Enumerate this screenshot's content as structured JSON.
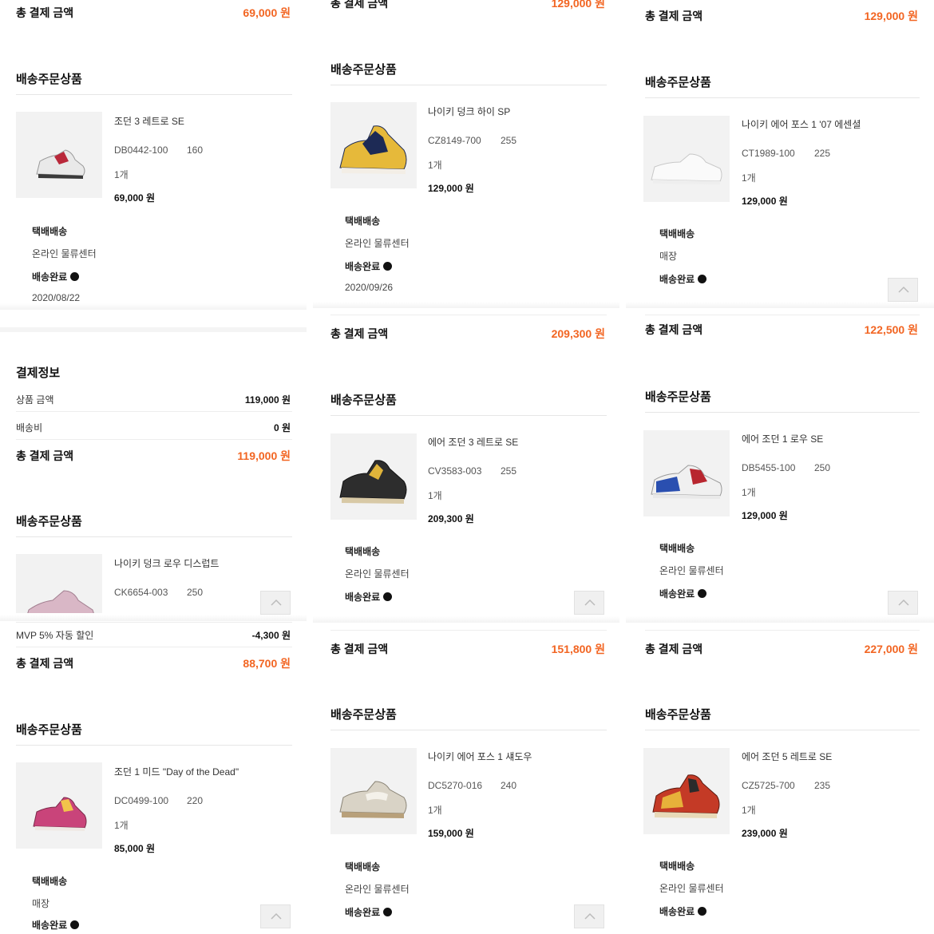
{
  "labels": {
    "total": "총 결제 금액",
    "section": "배송주문상품",
    "payment_info": "결제정보",
    "product_amount": "상품 금액",
    "shipping_fee": "배송비",
    "mvp_discount": "MVP 5% 자동 할인"
  },
  "panels": [
    {
      "id": "p1",
      "top_total": "69,000 원",
      "product": {
        "name": "조던 3 레트로 SE",
        "code": "DB0442-100",
        "size": "160",
        "qty": "1개",
        "price": "69,000 원",
        "icon": "sneaker-white-red-icon"
      },
      "delivery": {
        "method": "택배배송",
        "origin": "온라인 물류센터",
        "status": "배송완료",
        "date": "2020/08/22"
      }
    },
    {
      "id": "p2",
      "payment": {
        "product_amount": "119,000 원",
        "shipping_fee": "0 원",
        "total": "119,000 원"
      },
      "product": {
        "name": "나이키 덩크 로우 디스럽트",
        "code": "CK6654-003",
        "size": "250",
        "icon": "sneaker-pink-icon"
      },
      "discount": "-4,300 원",
      "total": "88,700 원"
    },
    {
      "id": "p3",
      "product": {
        "name": "조던 1 미드 \"Day of the Dead\"",
        "code": "DC0499-100",
        "size": "220",
        "qty": "1개",
        "price": "85,000 원",
        "icon": "sneaker-pink-multi-icon"
      },
      "delivery": {
        "method": "택배배송",
        "origin": "매장",
        "status": "배송완료"
      }
    },
    {
      "id": "p4",
      "top_total": "129,000 원",
      "product": {
        "name": "나이키 덩크 하이 SP",
        "code": "CZ8149-700",
        "size": "255",
        "qty": "1개",
        "price": "129,000 원",
        "icon": "sneaker-yellow-navy-icon"
      },
      "delivery": {
        "method": "택배배송",
        "origin": "온라인 물류센터",
        "status": "배송완료",
        "date": "2020/09/26"
      },
      "total": "209,300 원"
    },
    {
      "id": "p5",
      "product": {
        "name": "에어 조던 3 레트로 SE",
        "code": "CV3583-003",
        "size": "255",
        "qty": "1개",
        "price": "209,300 원",
        "icon": "sneaker-black-yellow-icon"
      },
      "delivery": {
        "method": "택배배송",
        "origin": "온라인 물류센터",
        "status": "배송완료"
      },
      "total": "151,800 원"
    },
    {
      "id": "p6",
      "product": {
        "name": "나이키 에어 포스 1 섀도우",
        "code": "DC5270-016",
        "size": "240",
        "qty": "1개",
        "price": "159,000 원",
        "icon": "sneaker-grey-beige-icon"
      },
      "delivery": {
        "method": "택배배송",
        "origin": "온라인 물류센터",
        "status": "배송완료"
      }
    },
    {
      "id": "p7",
      "top_total": "129,000 원",
      "product": {
        "name": "나이키 에어 포스 1 '07 에센셜",
        "code": "CT1989-100",
        "size": "225",
        "qty": "1개",
        "price": "129,000 원",
        "icon": "sneaker-white-icon"
      },
      "delivery": {
        "method": "택배배송",
        "origin": "매장",
        "status": "배송완료"
      },
      "total": "122,500 원"
    },
    {
      "id": "p8",
      "product": {
        "name": "에어 조던 1 로우 SE",
        "code": "DB5455-100",
        "size": "250",
        "qty": "1개",
        "price": "129,000 원",
        "icon": "sneaker-blue-red-icon"
      },
      "delivery": {
        "method": "택배배송",
        "origin": "온라인 물류센터",
        "status": "배송완료"
      },
      "total": "227,000 원"
    },
    {
      "id": "p9",
      "product": {
        "name": "에어 조던 5 레트로 SE",
        "code": "CZ5725-700",
        "size": "235",
        "qty": "1개",
        "price": "239,000 원",
        "icon": "sneaker-red-yellow-icon"
      },
      "delivery": {
        "method": "택배배송",
        "origin": "온라인 물류센터",
        "status": "배송완료"
      }
    }
  ],
  "icons": {
    "scroll_top": "chevron-up-icon",
    "status_dot": "status-dot-icon"
  },
  "colors": {
    "accent": "#f26522",
    "text": "#111111",
    "rule": "#e6e6e6"
  }
}
